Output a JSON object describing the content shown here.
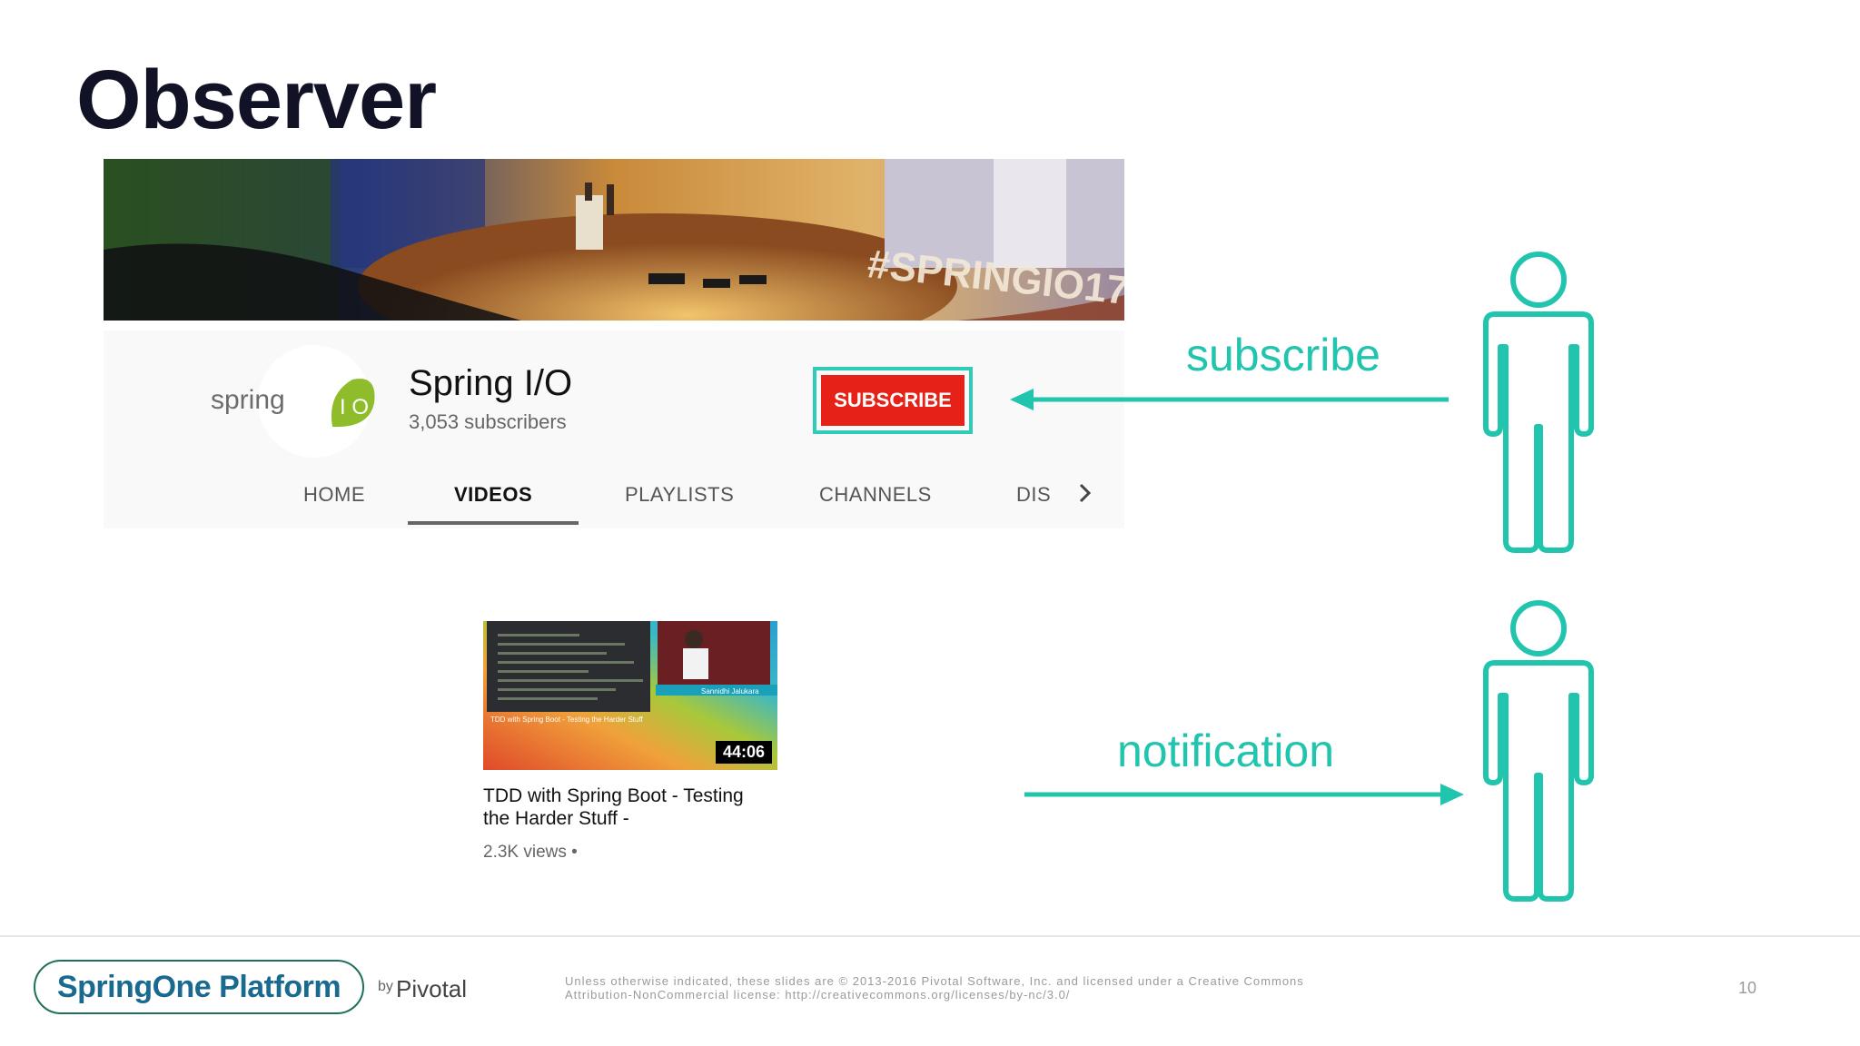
{
  "slide": {
    "title": "Observer",
    "page_number": "10"
  },
  "banner": {
    "sign_text": "#SPRINGIO17"
  },
  "channel": {
    "avatar_text": "spring",
    "avatar_badge": "I O",
    "name": "Spring I/O",
    "subscribers": "3,053 subscribers",
    "subscribe_label": "SUBSCRIBE",
    "tabs": [
      {
        "label": "HOME",
        "active": false
      },
      {
        "label": "VIDEOS",
        "active": true
      },
      {
        "label": "PLAYLISTS",
        "active": false
      },
      {
        "label": "CHANNELS",
        "active": false
      },
      {
        "label": "DIS",
        "active": false
      }
    ]
  },
  "video": {
    "thumb_caption": "TDD with Spring Boot - Testing the Harder Stuff",
    "presenter": "Sannidhi Jalukara",
    "duration": "44:06",
    "title": "TDD with Spring Boot - Testing the Harder Stuff -",
    "views": "2.3K views •"
  },
  "diagram": {
    "subscribe_label": "subscribe",
    "notification_label": "notification",
    "accent_color": "#21c4ad"
  },
  "footer": {
    "logo": "SpringOne Platform",
    "by": "by",
    "company": "Pivotal",
    "legal_line1": "Unless otherwise indicated, these slides are © 2013-2016 Pivotal Software, Inc. and licensed under a Creative Commons",
    "legal_line2": "Attribution-NonCommercial license: http://creativecommons.org/licenses/by-nc/3.0/"
  }
}
